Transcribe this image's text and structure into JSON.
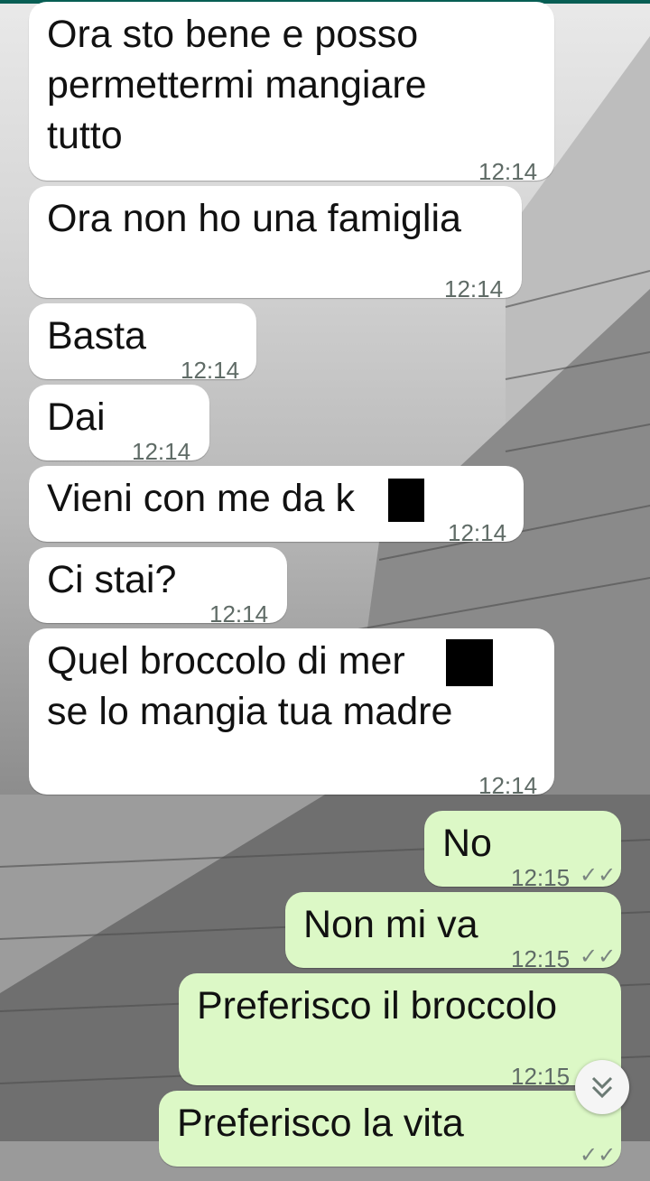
{
  "messages": [
    {
      "id": "m1",
      "direction": "in",
      "text": "Ora sto bene e posso\npermettermi mangiare\ntutto",
      "time": "12:14"
    },
    {
      "id": "m2",
      "direction": "in",
      "text": "Ora non ho una famiglia",
      "time": "12:14"
    },
    {
      "id": "m3",
      "direction": "in",
      "text": "Basta",
      "time": "12:14"
    },
    {
      "id": "m4",
      "direction": "in",
      "text": "Dai",
      "time": "12:14"
    },
    {
      "id": "m5",
      "direction": "in",
      "text": "Vieni con me da k",
      "time": "12:14"
    },
    {
      "id": "m6",
      "direction": "in",
      "text": "Ci stai?",
      "time": "12:14"
    },
    {
      "id": "m7",
      "direction": "in",
      "text": "Quel broccolo di mer\nse lo mangia tua madre",
      "time": "12:14"
    },
    {
      "id": "m8",
      "direction": "out",
      "text": "No",
      "time": "12:15",
      "status_icon": "read-double-check-icon"
    },
    {
      "id": "m9",
      "direction": "out",
      "text": "Non mi va",
      "time": "12:15",
      "status_icon": "read-double-check-icon"
    },
    {
      "id": "m10",
      "direction": "out",
      "text": "Preferisco il broccolo",
      "time": "12:15",
      "status_icon": "read-double-check-icon"
    },
    {
      "id": "m11",
      "direction": "out",
      "text": "Preferisco la vita",
      "time": "",
      "status_icon": "read-double-check-icon"
    }
  ],
  "scroll_button": {
    "icon": "double-chevron-down-icon"
  },
  "colors": {
    "incoming": "#ffffff",
    "outgoing": "#dcf8c6",
    "header": "#075e54"
  }
}
